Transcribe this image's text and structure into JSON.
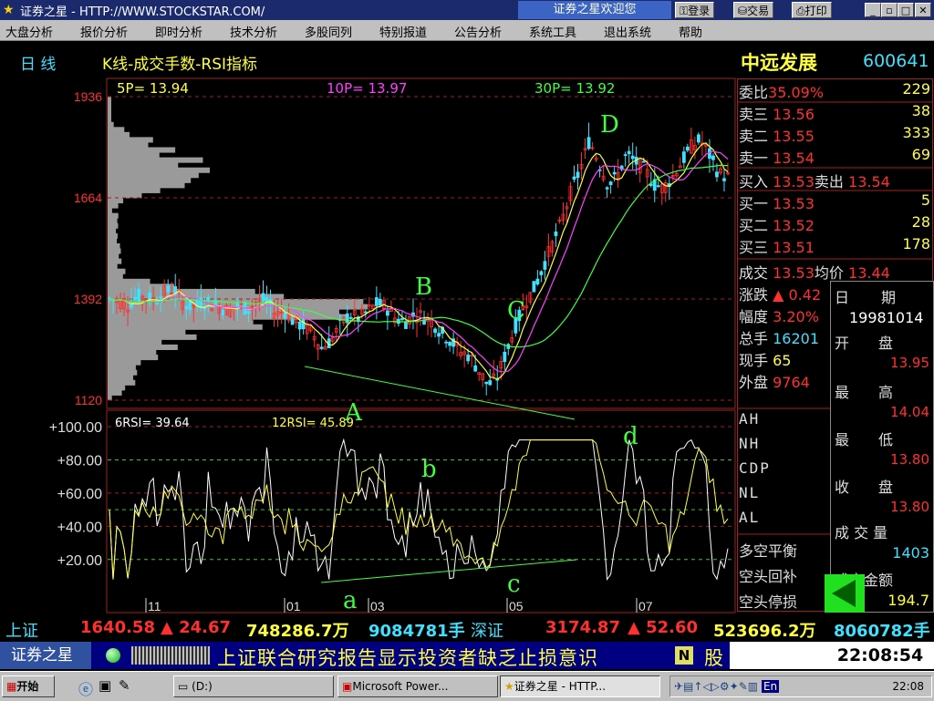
{
  "window": {
    "title": "证券之星 - HTTP://WWW.STOCKSTAR.COM/",
    "welcome": "证券之星欢迎您",
    "login": "登录",
    "trade": "交易",
    "print": "打印",
    "min": "_",
    "max": "▫",
    "restore": "🗗",
    "close": "✕"
  },
  "menu": [
    "大盘分析",
    "报价分析",
    "即时分析",
    "技术分析",
    "多股同列",
    "特别报道",
    "公告分析",
    "系统工具",
    "退出系统",
    "帮助"
  ],
  "header": {
    "period": "日  线",
    "indicator": "K线-成交手数-RSI指标",
    "stock_name": "中远发展",
    "stock_code": "600641",
    "ma5": "5P=  13.94",
    "ma10": "10P=  13.97",
    "ma30": "30P=  13.92",
    "rsi6": "6RSI=  39.64",
    "rsi12": "12RSI=  45.89"
  },
  "annotations": {
    "A": "A",
    "B": "B",
    "C": "C",
    "D": "D",
    "a": "a",
    "b": "b",
    "c": "c",
    "d": "d"
  },
  "chart_data": [
    {
      "type": "candlestick",
      "price_ticks": [
        "1936",
        "1664",
        "1392",
        "1120"
      ],
      "ylim": [
        1120,
        1936
      ],
      "x_ticks": [
        "11",
        "01",
        "03",
        "05",
        "07"
      ],
      "series": [
        {
          "name": "5P",
          "color": "#ffff40",
          "last": 13.94
        },
        {
          "name": "10P",
          "color": "#ff40ff",
          "last": 13.97
        },
        {
          "name": "30P",
          "color": "#40ff40",
          "last": 13.92
        }
      ],
      "price_path": [
        1392,
        1385,
        1375,
        1400,
        1395,
        1390,
        1410,
        1420,
        1380,
        1370,
        1385,
        1380,
        1370,
        1360,
        1375,
        1365,
        1385,
        1390,
        1350,
        1360,
        1330,
        1320,
        1300,
        1260,
        1280,
        1320,
        1350,
        1340,
        1360,
        1380,
        1370,
        1340,
        1330,
        1350,
        1345,
        1330,
        1300,
        1280,
        1250,
        1240,
        1200,
        1160,
        1180,
        1250,
        1320,
        1380,
        1420,
        1480,
        1540,
        1600,
        1680,
        1740,
        1820,
        1760,
        1700,
        1720,
        1780,
        1760,
        1740,
        1700,
        1690,
        1720,
        1760,
        1800,
        1820,
        1780,
        1730,
        1720
      ]
    },
    {
      "type": "line",
      "rsi_ticks": [
        "+100.00",
        "+80.00",
        "+60.00",
        "+40.00",
        "+20.00"
      ],
      "ylim": [
        0,
        100
      ],
      "series": [
        {
          "name": "6RSI",
          "color": "#ffffff",
          "last": 39.64
        },
        {
          "name": "12RSI",
          "color": "#ffff40",
          "last": 45.89
        }
      ]
    }
  ],
  "quote": {
    "weibi_label": "委比",
    "weibi_val": "35.09%",
    "weibi_num": "229",
    "sell3_label": "卖三",
    "sell3_price": "13.56",
    "sell3_vol": "38",
    "sell2_label": "卖二",
    "sell2_price": "13.55",
    "sell2_vol": "333",
    "sell1_label": "卖一",
    "sell1_price": "13.54",
    "sell1_vol": "69",
    "buyin_label": "买入",
    "buyin_price": "13.53",
    "sellout_label": "卖出",
    "sellout_price": "13.54",
    "buy1_label": "买一",
    "buy1_price": "13.53",
    "buy1_vol": "5",
    "buy2_label": "买二",
    "buy2_price": "13.52",
    "buy2_vol": "28",
    "buy3_label": "买三",
    "buy3_price": "13.51",
    "buy3_vol": "178",
    "deal_label": "成交",
    "deal_price": "13.53",
    "avg_label": "均价",
    "avg_price": "13.44",
    "change_label": "涨跌",
    "change_val": "▲ 0.42",
    "range_label": "幅度",
    "range_val": "3.20%",
    "total_label": "总手",
    "total_val": "16201",
    "now_label": "现手",
    "now_val": "65",
    "outer_label": "外盘",
    "outer_val": "9764",
    "ah": "AH",
    "nh": "NH",
    "cdp": "CDP",
    "nl": "NL",
    "al": "AL",
    "dk": "多空平衡",
    "kthb": "空头回补",
    "ktzs": "空头停损"
  },
  "popup": {
    "date_label": "日　　期",
    "date": "19981014",
    "open_label": "开　　盘",
    "open": "13.95",
    "high_label": "最　　高",
    "high": "14.04",
    "low_label": "最　　低",
    "low": "13.80",
    "close_label": "收　　盘",
    "close": "13.80",
    "vol_label": "成 交 量",
    "vol": "1403",
    "amt_label": "成交金额",
    "amt": "194.7"
  },
  "ticker": {
    "sh_label": "上证",
    "sh_idx": "1640.58",
    "sh_chg": "▲ 24.67",
    "sh_amt": "748286.7万",
    "sh_vol": "9084781手",
    "sz_label": "深证",
    "sz_idx": "3174.87",
    "sz_chg": "▲ 52.60",
    "sz_amt": "523696.2万",
    "sz_vol": "8060782手"
  },
  "status": {
    "brand": "证券之星",
    "message": "上证联合研究报告显示投资者缺乏止损意识",
    "n_badge": "N",
    "stock_tag": "股",
    "time": "22:08:54"
  },
  "taskbar": {
    "start": "开始",
    "drive": "(D:)",
    "ppt": "Microsoft Power...",
    "app": "证券之星 - HTTP...",
    "clock": "22:08",
    "en": "En"
  }
}
